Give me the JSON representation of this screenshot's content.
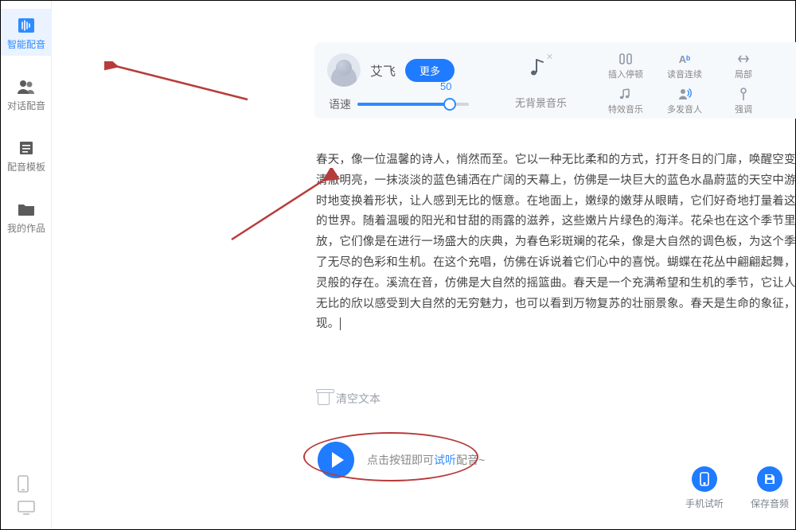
{
  "sidebar": {
    "items": [
      {
        "label": "智能配音"
      },
      {
        "label": "对话配音"
      },
      {
        "label": "配音模板"
      },
      {
        "label": "我的作品"
      }
    ]
  },
  "voice": {
    "name": "艾飞",
    "more_button": "更多",
    "speed_label": "语速",
    "speed_value": "50"
  },
  "bgm": {
    "label": "无背景音乐"
  },
  "tools": {
    "insert_pause": "插入停顿",
    "read_continuous": "读音连续",
    "local_right": "局部",
    "sfx": "特效音乐",
    "multi_voice": "多发音人",
    "emphasis": "强调"
  },
  "main_text": "春天，像一位温馨的诗人，悄然而至。它以一种无比柔和的方式，打开冬日的门扉，唤醒空变得格外清澈明亮，一抹淡淡的蓝色铺洒在广阔的天幕上，仿佛是一块巨大的蓝色水晶蔚蓝的天空中游荡，不时地变换着形状，让人感到无比的惬意。在地面上，嫩绿的嫩芽从眼睛，它们好奇地打量着这个全新的世界。随着温暖的阳光和甘甜的雨露的滋养，这些嫩片片绿色的海洋。花朵也在这个季节里争相开放，它们像是在进行一场盛大的庆典，为春色彩斑斓的花朵，像是大自然的调色板，为这个季节增添了无尽的色彩和生机。在这个充唱，仿佛在诉说着它们心中的喜悦。蝴蝶在花丛中翩翩起舞，宛如精灵般的存在。溪流在音，仿佛是大自然的摇篮曲。春天是一个充满希望和生机的季节，它让人们感到无比的欣以感受到大自然的无穷魅力，也可以看到万物复苏的壮丽景象。春天是生命的象征，也是现。",
  "clear_text_label": "清空文本",
  "play": {
    "hint_prefix": "点击按钮即可",
    "hint_highlight": "试听",
    "hint_suffix": "配音~"
  },
  "bottom_right": {
    "phone": "手机试听",
    "save": "保存音频"
  }
}
